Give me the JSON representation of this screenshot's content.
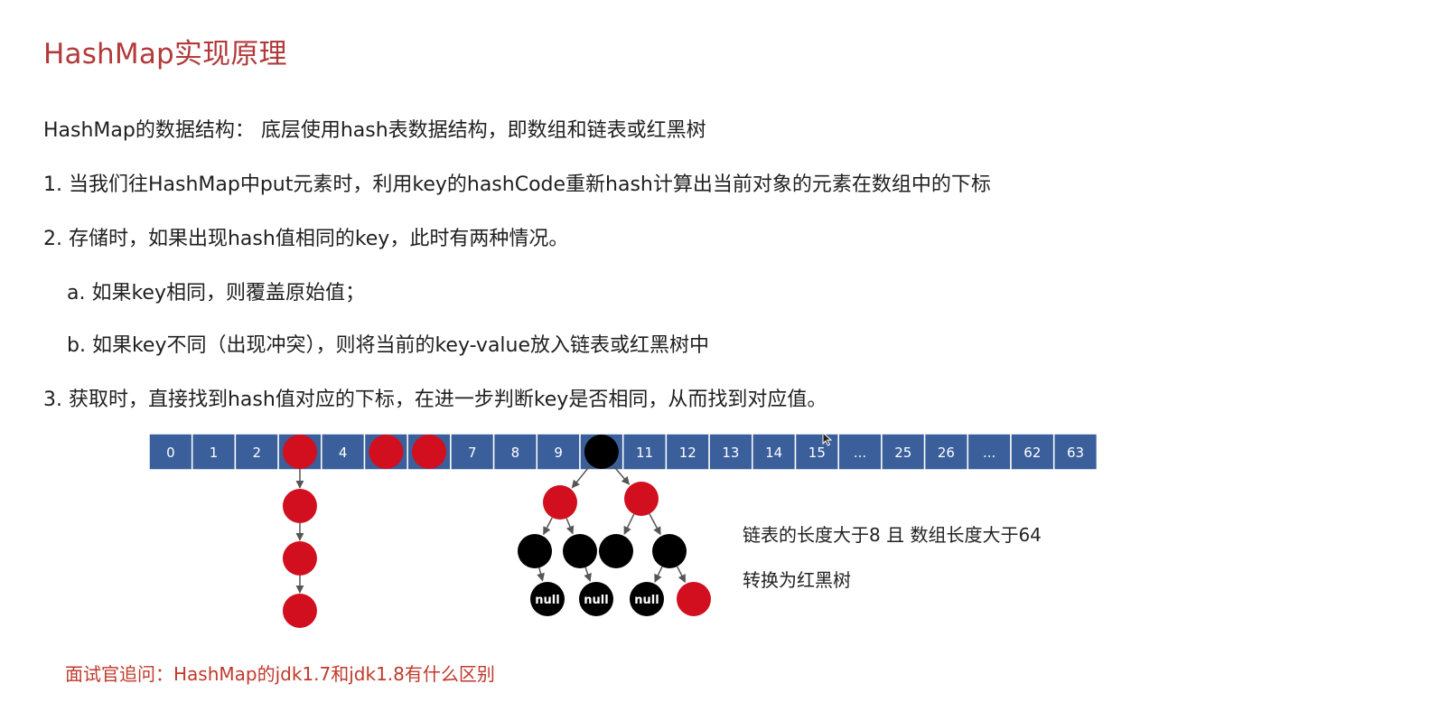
{
  "title": "HashMap实现原理",
  "lines": [
    "HashMap的数据结构：  底层使用hash表数据结构，即数组和链表或红黑树",
    "1. 当我们往HashMap中put元素时，利用key的hashCode重新hash计算出当前对象的元素在数组中的下标",
    "2. 存储时，如果出现hash值相同的key，此时有两种情况。",
    "a. 如果key相同，则覆盖原始值；",
    "b. 如果key不同（出现冲突），则将当前的key-value放入链表或红黑树中",
    "3. 获取时，直接找到hash值对应的下标，在进一步判断key是否相同，从而找到对应值。"
  ],
  "array_cells": [
    "0",
    "1",
    "2",
    "",
    "4",
    "",
    "",
    "7",
    "8",
    "9",
    "",
    "11",
    "12",
    "13",
    "14",
    "15",
    "...",
    "25",
    "26",
    "...",
    "62",
    "63"
  ],
  "tree_null_label": "null",
  "note_line1": "链表的长度大于8 且 数组长度大于64",
  "note_line2": "转换为红黑树",
  "footer": "面试官追问：HashMap的jdk1.7和jdk1.8有什么区别",
  "colors": {
    "title": "#b23a3a",
    "cell": "#3a5f9a",
    "red_node": "#d10f1f",
    "black_node": "#000000",
    "footer": "#c0392b"
  }
}
